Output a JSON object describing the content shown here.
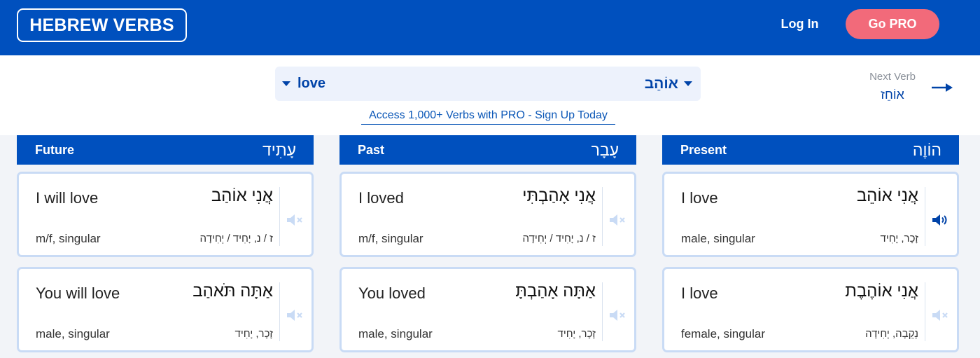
{
  "header": {
    "logo": "HEBREW VERBS",
    "login": "Log In",
    "go_pro": "Go PRO"
  },
  "search": {
    "english": "love",
    "hebrew": "אוֹהֵב",
    "dropdown_icon": "chevron-down-icon"
  },
  "promo": "Access 1,000+ Verbs with PRO - Sign Up Today",
  "next": {
    "label": "Next Verb",
    "verb": "אוֹחֵז",
    "icon": "arrow-right-icon"
  },
  "colors": {
    "brand_blue": "#0050BE",
    "pro_pink": "#F26A7A",
    "card_border": "#C9DBF5"
  },
  "columns": [
    {
      "title": "Future",
      "title_he": "עָתִיד",
      "cards": [
        {
          "en": "I will love",
          "he": "אֲנִי אוֹהַב",
          "en_meta": "m/f, singular",
          "he_meta": "ז / נ, יָחִיד / יְחִידָה",
          "audio": "muted"
        },
        {
          "en": "You will love",
          "he": "אַתָּה תֹּאהַב",
          "en_meta": "male, singular",
          "he_meta": "זָכָר, יָחִיד",
          "audio": "muted"
        }
      ]
    },
    {
      "title": "Past",
      "title_he": "עָבָר",
      "cards": [
        {
          "en": "I loved",
          "he": "אֲנִי אָהַבְתִּי",
          "en_meta": "m/f, singular",
          "he_meta": "ז / נ, יָחִיד / יְחִידָה",
          "audio": "muted"
        },
        {
          "en": "You loved",
          "he": "אַתָּה אָהַבְתָּ",
          "en_meta": "male, singular",
          "he_meta": "זָכָר, יָחִיד",
          "audio": "muted"
        }
      ]
    },
    {
      "title": "Present",
      "title_he": "הוֹוֶה",
      "cards": [
        {
          "en": "I love",
          "he": "אֲנִי אוֹהֵב",
          "en_meta": "male, singular",
          "he_meta": "זָכָר, יָחִיד",
          "audio": "active"
        },
        {
          "en": "I love",
          "he": "אֲנִי אוֹהֶבֶת",
          "en_meta": "female, singular",
          "he_meta": "נְקֵבָה, יְחִידָה",
          "audio": "muted"
        }
      ]
    }
  ]
}
